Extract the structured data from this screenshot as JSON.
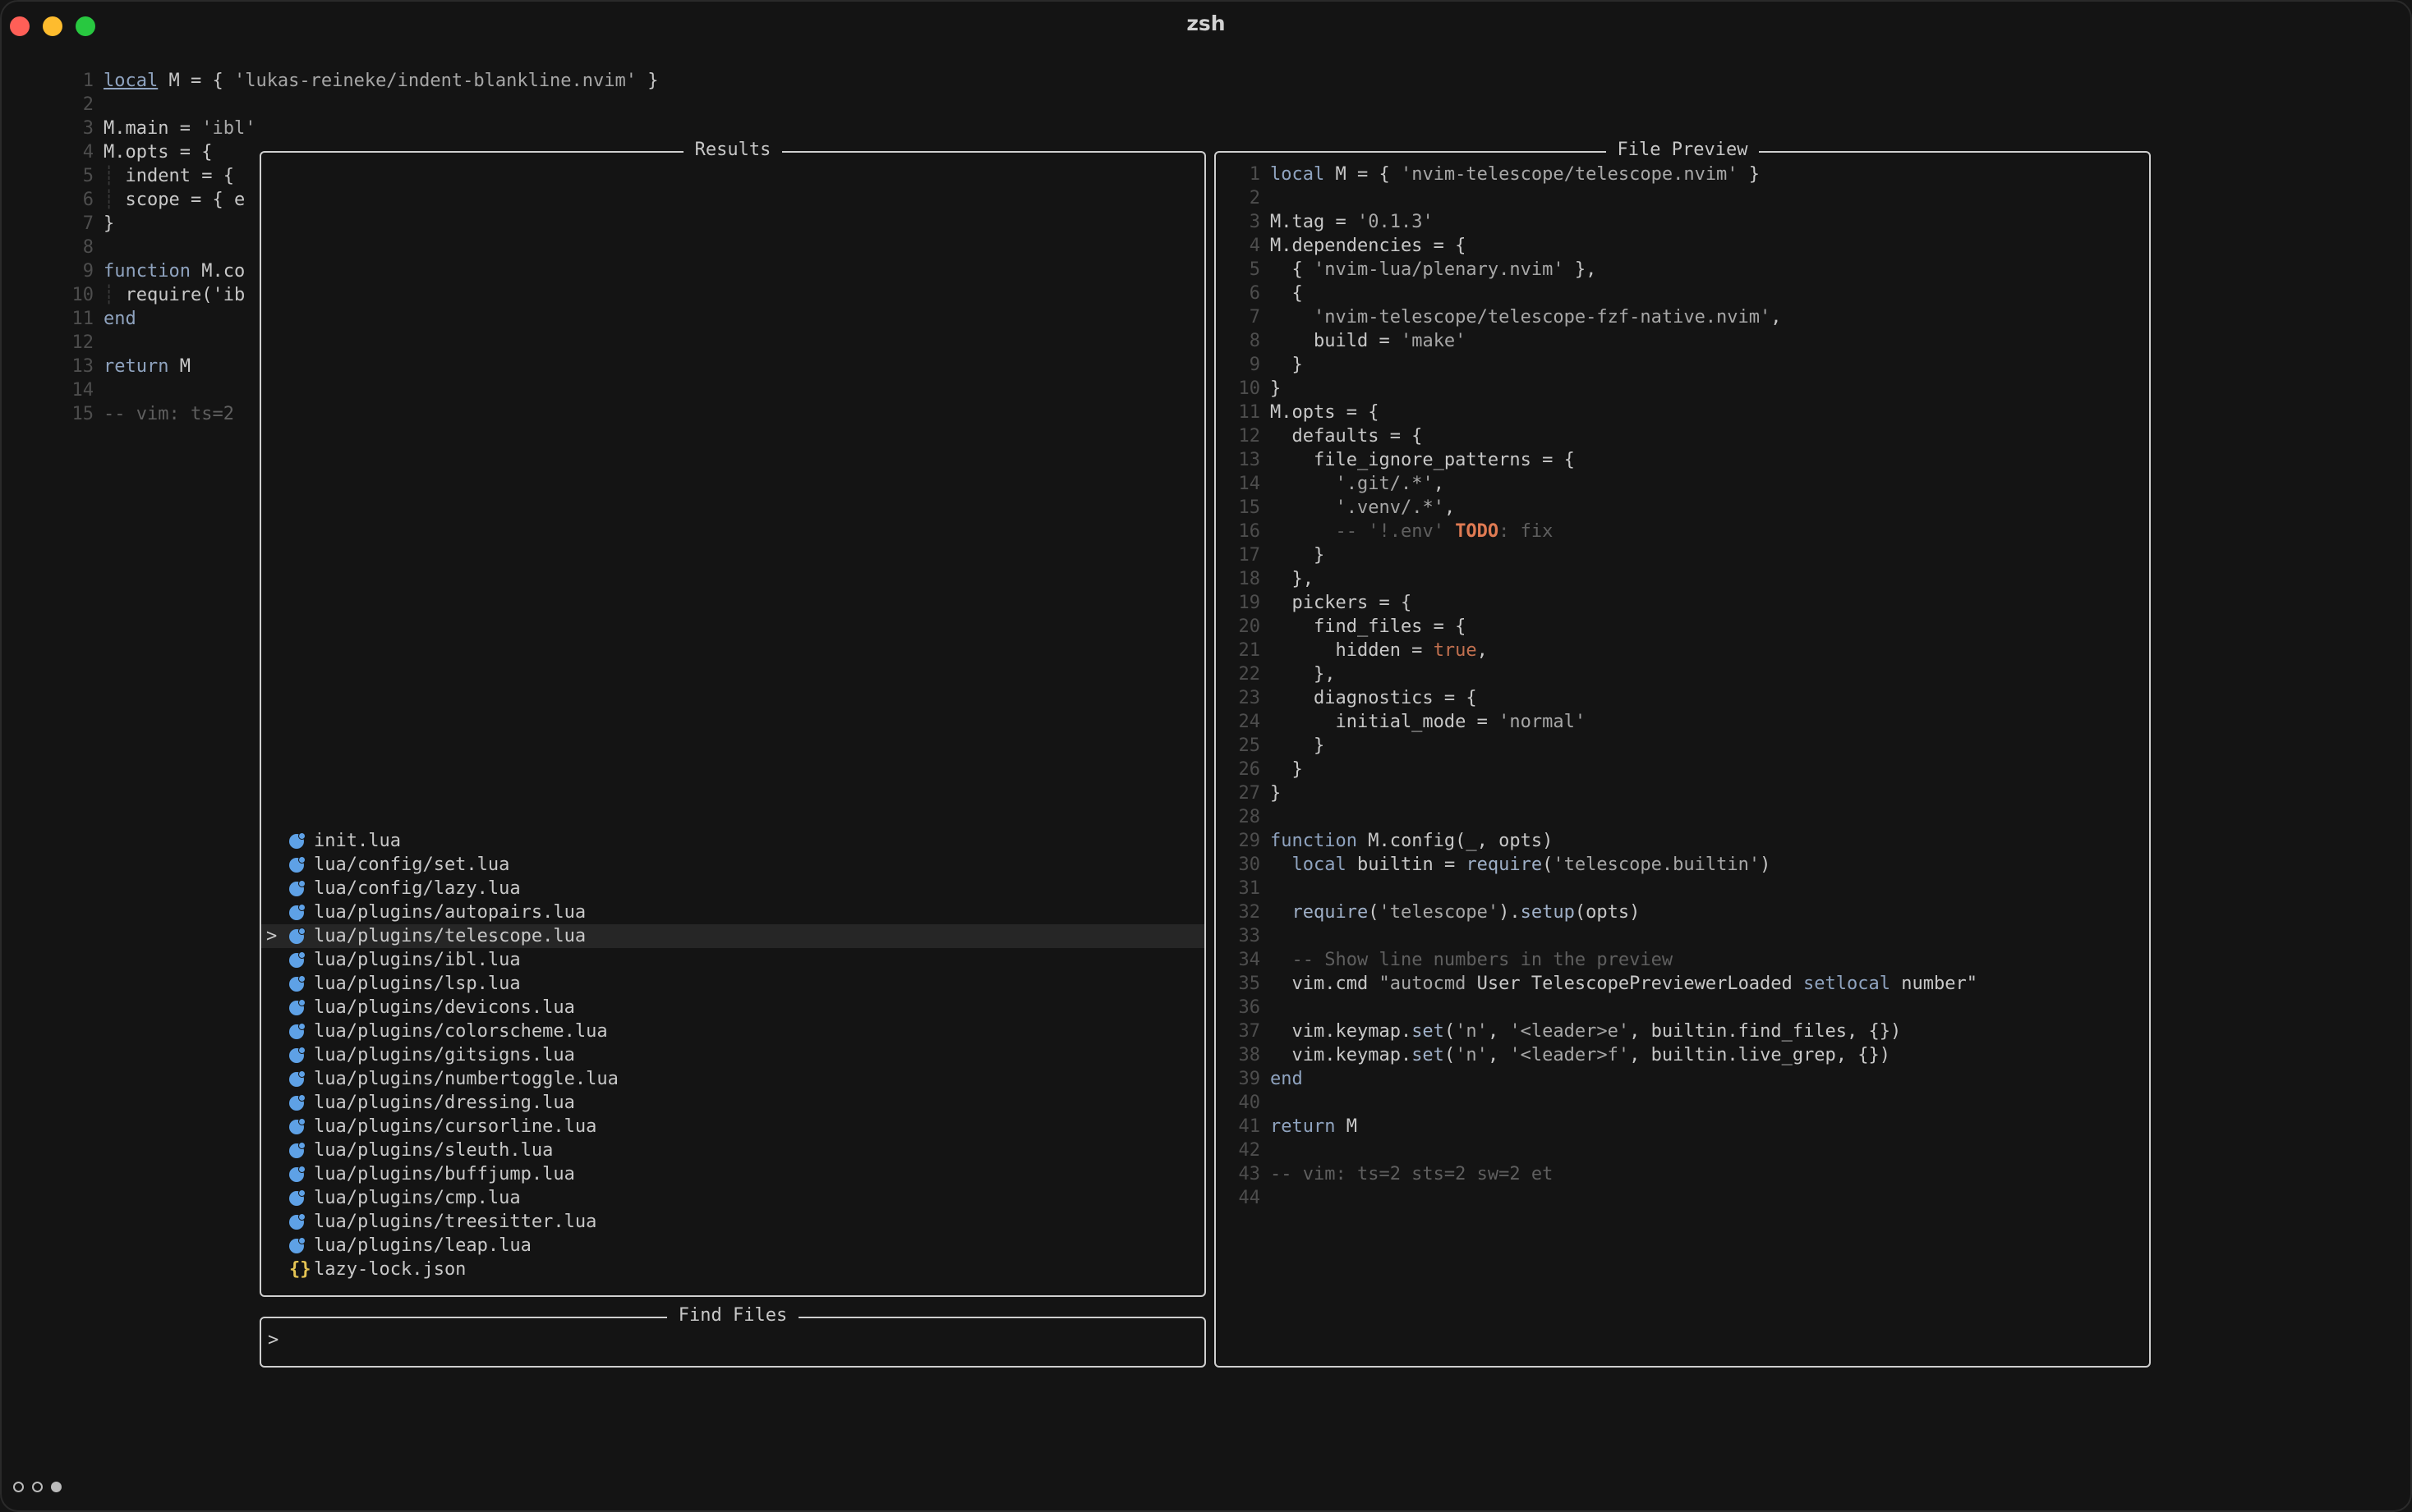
{
  "window": {
    "title": "zsh"
  },
  "background_editor": {
    "lines": [
      {
        "n": "1",
        "parts": [
          [
            "local",
            "kw u"
          ],
          [
            " M = { ",
            ""
          ],
          [
            "'lukas-reineke/indent-blankline.nvim'",
            "str"
          ],
          [
            " }",
            ""
          ]
        ]
      },
      {
        "n": "2",
        "parts": []
      },
      {
        "n": "3",
        "parts": [
          [
            "M.main = ",
            ""
          ],
          [
            "'ibl'",
            "str"
          ]
        ]
      },
      {
        "n": "4",
        "parts": [
          [
            "M.opts = {",
            ""
          ]
        ]
      },
      {
        "n": "5",
        "parts": [
          [
            "┊ ",
            "ibar"
          ],
          [
            "indent = {",
            ""
          ]
        ]
      },
      {
        "n": "6",
        "parts": [
          [
            "┊ ",
            "ibar"
          ],
          [
            "scope = { e",
            ""
          ]
        ]
      },
      {
        "n": "7",
        "parts": [
          [
            "}",
            ""
          ]
        ]
      },
      {
        "n": "8",
        "parts": []
      },
      {
        "n": "9",
        "parts": [
          [
            "function",
            "kw"
          ],
          [
            " M.co",
            ""
          ]
        ]
      },
      {
        "n": "10",
        "parts": [
          [
            "┊ ",
            "ibar"
          ],
          [
            "require('ib",
            ""
          ]
        ]
      },
      {
        "n": "11",
        "parts": [
          [
            "end",
            "kw"
          ]
        ]
      },
      {
        "n": "12",
        "parts": []
      },
      {
        "n": "13",
        "parts": [
          [
            "return",
            "kw"
          ],
          [
            " M",
            ""
          ]
        ]
      },
      {
        "n": "14",
        "parts": []
      },
      {
        "n": "15",
        "parts": [
          [
            "-- vim: ts=2",
            "com"
          ]
        ]
      }
    ]
  },
  "results_panel": {
    "title": "Results",
    "items": [
      {
        "path": "init.lua",
        "icon": "lua-icon"
      },
      {
        "path": "lua/config/set.lua",
        "icon": "lua-icon"
      },
      {
        "path": "lua/config/lazy.lua",
        "icon": "lua-icon"
      },
      {
        "path": "lua/plugins/autopairs.lua",
        "icon": "lua-icon"
      },
      {
        "path": "lua/plugins/telescope.lua",
        "icon": "lua-icon",
        "selected": true
      },
      {
        "path": "lua/plugins/ibl.lua",
        "icon": "lua-icon"
      },
      {
        "path": "lua/plugins/lsp.lua",
        "icon": "lua-icon"
      },
      {
        "path": "lua/plugins/devicons.lua",
        "icon": "lua-icon"
      },
      {
        "path": "lua/plugins/colorscheme.lua",
        "icon": "lua-icon"
      },
      {
        "path": "lua/plugins/gitsigns.lua",
        "icon": "lua-icon"
      },
      {
        "path": "lua/plugins/numbertoggle.lua",
        "icon": "lua-icon"
      },
      {
        "path": "lua/plugins/dressing.lua",
        "icon": "lua-icon"
      },
      {
        "path": "lua/plugins/cursorline.lua",
        "icon": "lua-icon"
      },
      {
        "path": "lua/plugins/sleuth.lua",
        "icon": "lua-icon"
      },
      {
        "path": "lua/plugins/buffjump.lua",
        "icon": "lua-icon"
      },
      {
        "path": "lua/plugins/cmp.lua",
        "icon": "lua-icon"
      },
      {
        "path": "lua/plugins/treesitter.lua",
        "icon": "lua-icon"
      },
      {
        "path": "lua/plugins/leap.lua",
        "icon": "lua-icon"
      },
      {
        "path": "lazy-lock.json",
        "icon": "json-icon"
      }
    ],
    "selection_caret": ">"
  },
  "prompt_panel": {
    "title": "Find Files",
    "caret": ">"
  },
  "preview_panel": {
    "title": "File Preview",
    "lines": [
      {
        "n": "1",
        "parts": [
          [
            "local",
            "kw"
          ],
          [
            " M = { ",
            ""
          ],
          [
            "'nvim-telescope/telescope.nvim'",
            "str"
          ],
          [
            " }",
            ""
          ]
        ]
      },
      {
        "n": "2",
        "parts": []
      },
      {
        "n": "3",
        "parts": [
          [
            "M.tag = ",
            ""
          ],
          [
            "'0.1.3'",
            "str"
          ]
        ]
      },
      {
        "n": "4",
        "parts": [
          [
            "M.dependencies = {",
            ""
          ]
        ]
      },
      {
        "n": "5",
        "parts": [
          [
            "  { ",
            ""
          ],
          [
            "'nvim-lua/plenary.nvim'",
            "str"
          ],
          [
            " },",
            ""
          ]
        ]
      },
      {
        "n": "6",
        "parts": [
          [
            "  {",
            ""
          ]
        ]
      },
      {
        "n": "7",
        "parts": [
          [
            "    ",
            ""
          ],
          [
            "'nvim-telescope/telescope-fzf-native.nvim'",
            "str"
          ],
          [
            ",",
            ""
          ]
        ]
      },
      {
        "n": "8",
        "parts": [
          [
            "    build = ",
            ""
          ],
          [
            "'make'",
            "str"
          ]
        ]
      },
      {
        "n": "9",
        "parts": [
          [
            "  }",
            ""
          ]
        ]
      },
      {
        "n": "10",
        "parts": [
          [
            "}",
            ""
          ]
        ]
      },
      {
        "n": "11",
        "parts": [
          [
            "M.opts = {",
            ""
          ]
        ]
      },
      {
        "n": "12",
        "parts": [
          [
            "  defaults = {",
            ""
          ]
        ]
      },
      {
        "n": "13",
        "parts": [
          [
            "    file_ignore_patterns = {",
            ""
          ]
        ]
      },
      {
        "n": "14",
        "parts": [
          [
            "      ",
            ""
          ],
          [
            "'.git/.*'",
            "str"
          ],
          [
            ",",
            ""
          ]
        ]
      },
      {
        "n": "15",
        "parts": [
          [
            "      ",
            ""
          ],
          [
            "'.venv/.*'",
            "str"
          ],
          [
            ",",
            ""
          ]
        ]
      },
      {
        "n": "16",
        "parts": [
          [
            "      ",
            ""
          ],
          [
            "-- '!.env' ",
            "com"
          ],
          [
            "TODO",
            "todo"
          ],
          [
            ": fix",
            "com"
          ]
        ]
      },
      {
        "n": "17",
        "parts": [
          [
            "    }",
            ""
          ]
        ]
      },
      {
        "n": "18",
        "parts": [
          [
            "  },",
            ""
          ]
        ]
      },
      {
        "n": "19",
        "parts": [
          [
            "  pickers = {",
            ""
          ]
        ]
      },
      {
        "n": "20",
        "parts": [
          [
            "    find_files = {",
            ""
          ]
        ]
      },
      {
        "n": "21",
        "parts": [
          [
            "      hidden = ",
            ""
          ],
          [
            "true",
            "bool"
          ],
          [
            ",",
            ""
          ]
        ]
      },
      {
        "n": "22",
        "parts": [
          [
            "    },",
            ""
          ]
        ]
      },
      {
        "n": "23",
        "parts": [
          [
            "    diagnostics = {",
            ""
          ]
        ]
      },
      {
        "n": "24",
        "parts": [
          [
            "      initial_mode = ",
            ""
          ],
          [
            "'normal'",
            "str"
          ]
        ]
      },
      {
        "n": "25",
        "parts": [
          [
            "    }",
            ""
          ]
        ]
      },
      {
        "n": "26",
        "parts": [
          [
            "  }",
            ""
          ]
        ]
      },
      {
        "n": "27",
        "parts": [
          [
            "}",
            ""
          ]
        ]
      },
      {
        "n": "28",
        "parts": []
      },
      {
        "n": "29",
        "parts": [
          [
            "function",
            "kw"
          ],
          [
            " M.config(_, opts)",
            ""
          ]
        ]
      },
      {
        "n": "30",
        "parts": [
          [
            "  ",
            ""
          ],
          [
            "local",
            "kw"
          ],
          [
            " builtin = ",
            ""
          ],
          [
            "require",
            "fn"
          ],
          [
            "(",
            ""
          ],
          [
            "'telescope.builtin'",
            "str"
          ],
          [
            ")",
            ""
          ]
        ]
      },
      {
        "n": "31",
        "parts": []
      },
      {
        "n": "32",
        "parts": [
          [
            "  ",
            ""
          ],
          [
            "require",
            "fn"
          ],
          [
            "(",
            ""
          ],
          [
            "'telescope'",
            "str"
          ],
          [
            ").",
            ""
          ],
          [
            "setup",
            "fn"
          ],
          [
            "(opts)",
            ""
          ]
        ]
      },
      {
        "n": "33",
        "parts": []
      },
      {
        "n": "34",
        "parts": [
          [
            "  ",
            ""
          ],
          [
            "-- Show line numbers in the preview",
            "com"
          ]
        ]
      },
      {
        "n": "35",
        "parts": [
          [
            "  vim.cmd ",
            ""
          ],
          [
            "\"autocmd ",
            "str"
          ],
          [
            "User ",
            ""
          ],
          [
            "TelescopePreviewerLoaded ",
            ""
          ],
          [
            "setlocal",
            "kw"
          ],
          [
            " number\"",
            ""
          ]
        ]
      },
      {
        "n": "36",
        "parts": []
      },
      {
        "n": "37",
        "parts": [
          [
            "  vim.keymap.",
            ""
          ],
          [
            "set",
            "fn"
          ],
          [
            "(",
            ""
          ],
          [
            "'n'",
            "str"
          ],
          [
            ", ",
            ""
          ],
          [
            "'<leader>e'",
            "str"
          ],
          [
            ", builtin.find_files, {})",
            ""
          ]
        ]
      },
      {
        "n": "38",
        "parts": [
          [
            "  vim.keymap.",
            ""
          ],
          [
            "set",
            "fn"
          ],
          [
            "(",
            ""
          ],
          [
            "'n'",
            "str"
          ],
          [
            ", ",
            ""
          ],
          [
            "'<leader>f'",
            "str"
          ],
          [
            ", builtin.live_grep, {})",
            ""
          ]
        ]
      },
      {
        "n": "39",
        "parts": [
          [
            "end",
            "kw"
          ]
        ]
      },
      {
        "n": "40",
        "parts": []
      },
      {
        "n": "41",
        "parts": [
          [
            "return",
            "kw"
          ],
          [
            " M",
            ""
          ]
        ]
      },
      {
        "n": "42",
        "parts": []
      },
      {
        "n": "43",
        "parts": [
          [
            "-- vim: ts=2 sts=2 sw=2 et",
            "com"
          ]
        ]
      },
      {
        "n": "44",
        "parts": []
      }
    ]
  },
  "statusline": {
    "dots": [
      "empty",
      "empty",
      "filled"
    ]
  }
}
